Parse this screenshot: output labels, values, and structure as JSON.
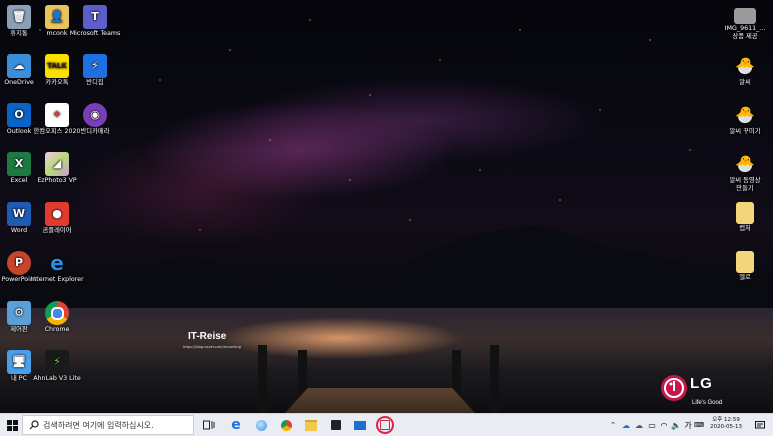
{
  "desktop": {
    "left_icons": [
      {
        "label": "휴지통",
        "icon": "recycle-bin-icon",
        "color": "#8aa0b8"
      },
      {
        "label": "mconk",
        "icon": "user-folder-icon",
        "color": "#e8c35a"
      },
      {
        "label": "Microsoft Teams",
        "icon": "teams-icon",
        "color": "#5b5fc7"
      },
      {
        "label": "OneDrive",
        "icon": "onedrive-icon",
        "color": "#f2c94c"
      },
      {
        "label": "카카오톡",
        "icon": "kakaotalk-icon",
        "color": "#f9e000"
      },
      {
        "label": "반디집",
        "icon": "bandizip-icon",
        "color": "#1e6fe0"
      },
      {
        "label": "Outlook",
        "icon": "outlook-icon",
        "color": "#0a64c8"
      },
      {
        "label": "한컴오피스 2020",
        "icon": "hancom-office-icon",
        "color": "#ffffff"
      },
      {
        "label": "반디카메라",
        "icon": "bandicam-icon",
        "color": "#7a3fb8"
      },
      {
        "label": "Excel",
        "icon": "excel-icon",
        "color": "#1d7a43"
      },
      {
        "label": "EzPhoto3 VP",
        "icon": "ezphoto-icon",
        "color": "#c8a0d8"
      },
      {
        "label": "Word",
        "icon": "word-icon",
        "color": "#1f5bb5"
      },
      {
        "label": "곰플레이어",
        "icon": "gomplayer-icon",
        "color": "#e23b2e"
      },
      {
        "label": "PowerPoint",
        "icon": "powerpoint-icon",
        "color": "#c8452b"
      },
      {
        "label": "Internet Explorer",
        "icon": "internet-explorer-icon",
        "color": "#2a8ee0"
      },
      {
        "label": "제어판",
        "icon": "control-panel-icon",
        "color": "#5aa0d8"
      },
      {
        "label": "Chrome",
        "icon": "chrome-icon",
        "color": "#ffffff"
      },
      {
        "label": "내 PC",
        "icon": "this-pc-icon",
        "color": "#4aa0e8"
      },
      {
        "label": "AhnLab V3 Lite",
        "icon": "ahnlab-v3-icon",
        "color": "#1a1a1a"
      }
    ],
    "right_icons": [
      {
        "label": "IMG_9611_...\n상품 제공",
        "icon": "image-file-icon"
      },
      {
        "label": "알씨",
        "icon": "alsee-icon"
      },
      {
        "label": "알씨 꾸미기",
        "icon": "alsee-decorate-icon"
      },
      {
        "label": "알씨 동영상\n만들기",
        "icon": "alsee-video-icon"
      },
      {
        "label": "캡처",
        "icon": "folder-icon"
      },
      {
        "label": "엘로",
        "icon": "folder-icon"
      }
    ],
    "watermark_title": "IT-Reise",
    "watermark_url": "https://blog.naver.com/mconking",
    "brand": "LG",
    "brand_tagline": "Life's Good"
  },
  "taskbar": {
    "search_placeholder": "검색하려면 여기에 입력하십시오.",
    "ime_label": "가",
    "time": "오후 12:59",
    "date": "2020-05-13",
    "accent": "#d8264a"
  }
}
